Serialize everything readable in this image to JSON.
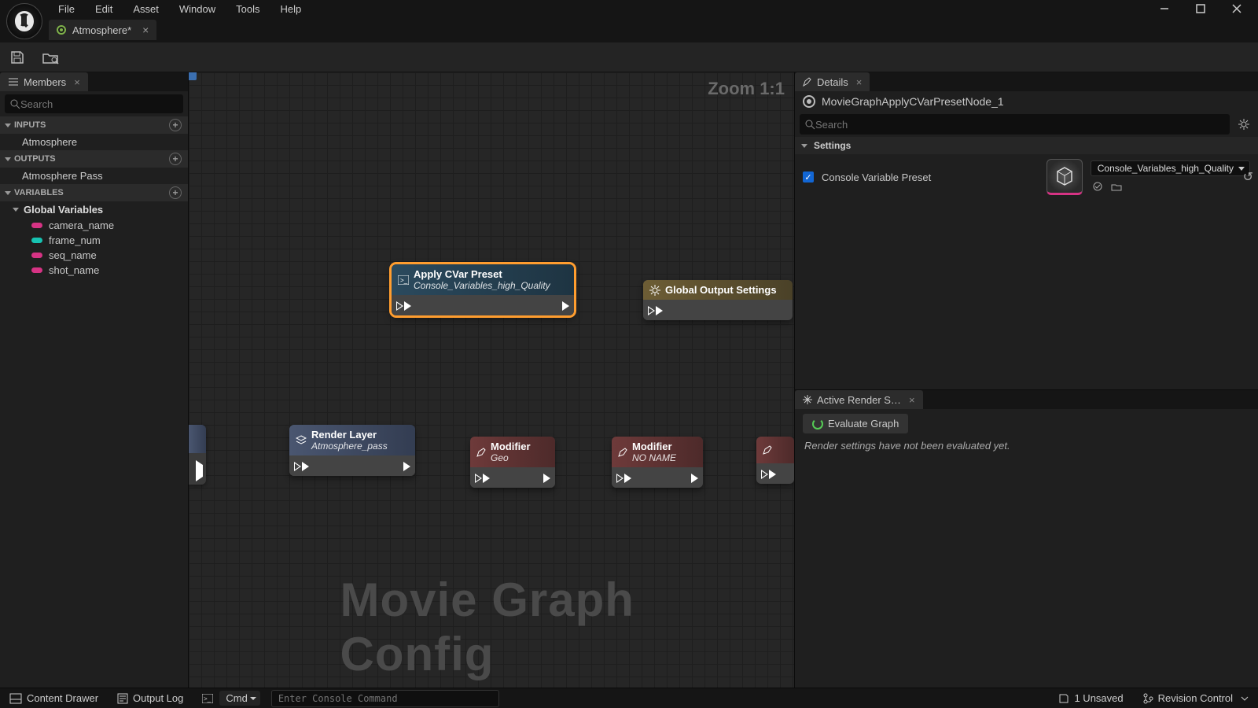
{
  "menu": {
    "file": "File",
    "edit": "Edit",
    "asset": "Asset",
    "window": "Window",
    "tools": "Tools",
    "help": "Help"
  },
  "tab": {
    "name": "Atmosphere*"
  },
  "members": {
    "title": "Members",
    "search_ph": "Search",
    "inputs_hdr": "INPUTS",
    "inputs": [
      "Atmosphere"
    ],
    "outputs_hdr": "OUTPUTS",
    "outputs": [
      "Atmosphere Pass"
    ],
    "vars_hdr": "VARIABLES",
    "global_hdr": "Global Variables",
    "vars": [
      {
        "name": "camera_name",
        "c": "mag"
      },
      {
        "name": "frame_num",
        "c": "teal"
      },
      {
        "name": "seq_name",
        "c": "mag"
      },
      {
        "name": "shot_name",
        "c": "mag"
      }
    ]
  },
  "graph": {
    "zoom": "Zoom 1:1",
    "watermark": "Movie Graph Config",
    "n_cvar": {
      "title": "Apply CVar Preset",
      "sub": "Console_Variables_high_Quality"
    },
    "n_global": {
      "title": "Global Output Settings"
    },
    "n_render": {
      "title": "Render Layer",
      "sub": "Atmosphere_pass"
    },
    "n_mod1": {
      "title": "Modifier",
      "sub": "Geo"
    },
    "n_mod2": {
      "title": "Modifier",
      "sub": "NO NAME"
    }
  },
  "details": {
    "title": "Details",
    "node": "MovieGraphApplyCVarPresetNode_1",
    "search_ph": "Search",
    "section": "Settings",
    "prop": "Console Variable Preset",
    "asset": "Console_Variables_high_Quality"
  },
  "render": {
    "title": "Active Render S…",
    "btn": "Evaluate Graph",
    "msg": "Render settings have not been evaluated yet."
  },
  "status": {
    "drawer": "Content Drawer",
    "log": "Output Log",
    "cmd": "Cmd",
    "cmd_ph": "Enter Console Command",
    "unsaved": "1 Unsaved",
    "rev": "Revision Control"
  }
}
